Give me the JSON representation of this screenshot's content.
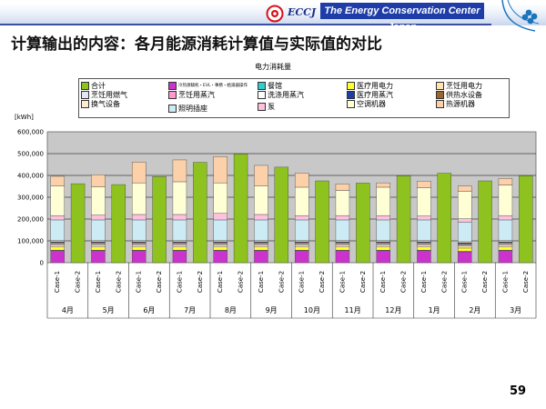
{
  "header": {
    "org_short": "ECCJ",
    "org_name": "The Energy Conservation Center Japan"
  },
  "slide": {
    "title": "计算输出的内容：各月能源消耗计算值与实际值的对比",
    "page_number": "59"
  },
  "chart_data": {
    "type": "bar",
    "stacked": true,
    "title": "电力消耗量",
    "ylabel": "[kWh]",
    "ylim": [
      0,
      600000
    ],
    "yticks": [
      "0",
      "100,000",
      "200,000",
      "300,000",
      "400,000",
      "500,000",
      "600,000"
    ],
    "grid": true,
    "legend_position": "top",
    "months": [
      "4月",
      "5月",
      "6月",
      "7月",
      "8月",
      "9月",
      "10月",
      "11月",
      "12月",
      "1月",
      "2月",
      "3月"
    ],
    "case_labels": [
      "Case-1",
      "Case-2"
    ],
    "series": [
      {
        "name": "合计",
        "color": "#8dc21f",
        "case": "Case-2",
        "values": [
          362000,
          358000,
          395000,
          460000,
          498000,
          438000,
          375000,
          365000,
          398000,
          410000,
          375000,
          398000
        ]
      },
      {
        "name": "冷热源辅机・EVL・事務・給湯器操作",
        "color": "#cc33cc",
        "case": "Case-1",
        "values": [
          55000,
          55000,
          55000,
          55000,
          55000,
          55000,
          55000,
          55000,
          55000,
          55000,
          50000,
          55000
        ]
      },
      {
        "name": "餐馆",
        "color": "#33cccc",
        "case": "Case-1",
        "values": [
          2000,
          2000,
          2000,
          2000,
          2000,
          2000,
          2000,
          2000,
          2000,
          2000,
          2000,
          2000
        ]
      },
      {
        "name": "医疗用电力",
        "color": "#ffff33",
        "case": "Case-1",
        "values": [
          15000,
          15000,
          15000,
          15000,
          15000,
          15000,
          15000,
          15000,
          15000,
          15000,
          15000,
          15000
        ]
      },
      {
        "name": "烹饪用电力",
        "color": "#ffe3b0",
        "case": "Case-1",
        "values": [
          10000,
          10000,
          10000,
          10000,
          10000,
          10000,
          10000,
          10000,
          10000,
          10000,
          10000,
          10000
        ]
      },
      {
        "name": "烹饪用燃气",
        "color": "#e6e6f2",
        "case": "Case-1",
        "values": [
          5000,
          5000,
          5000,
          5000,
          5000,
          5000,
          5000,
          5000,
          5000,
          5000,
          5000,
          5000
        ]
      },
      {
        "name": "烹饪用蒸汽",
        "color": "#ff99cc",
        "case": "Case-1",
        "values": [
          3000,
          3000,
          3000,
          3000,
          3000,
          3000,
          3000,
          3000,
          3000,
          3000,
          3000,
          3000
        ]
      },
      {
        "name": "洗涤用蒸汽",
        "color": "#ffffff",
        "case": "Case-1",
        "values": [
          3000,
          3000,
          3000,
          3000,
          3000,
          3000,
          3000,
          3000,
          3000,
          3000,
          3000,
          3000
        ]
      },
      {
        "name": "医疗用蒸汽",
        "color": "#1f3da8",
        "case": "Case-1",
        "values": [
          1000,
          1000,
          1000,
          1000,
          1000,
          1000,
          1000,
          1000,
          1000,
          1000,
          1000,
          1000
        ]
      },
      {
        "name": "供热水设备",
        "color": "#996633",
        "case": "Case-1",
        "values": [
          2000,
          2000,
          2000,
          2000,
          2000,
          2000,
          2000,
          2000,
          2000,
          2000,
          2000,
          2000
        ]
      },
      {
        "name": "换气设备",
        "color": "#ffebd0",
        "case": "Case-1",
        "values": [
          5000,
          5000,
          5000,
          5000,
          5000,
          5000,
          5000,
          5000,
          5000,
          5000,
          5000,
          5000
        ]
      },
      {
        "name": "照明插座",
        "color": "#ccebf5",
        "case": "Case-1",
        "values": [
          95000,
          95000,
          95000,
          95000,
          95000,
          95000,
          95000,
          95000,
          95000,
          95000,
          90000,
          95000
        ]
      },
      {
        "name": "泵",
        "color": "#ffc0e0",
        "case": "Case-1",
        "values": [
          20000,
          22000,
          25000,
          25000,
          30000,
          25000,
          20000,
          20000,
          20000,
          18000,
          15000,
          20000
        ]
      },
      {
        "name": "空调机器",
        "color": "#ffffd6",
        "case": "Case-1",
        "values": [
          135000,
          130000,
          145000,
          150000,
          140000,
          130000,
          130000,
          115000,
          130000,
          130000,
          125000,
          140000
        ]
      },
      {
        "name": "热源机器",
        "color": "#fcd0a8",
        "case": "Case-1",
        "values": [
          45000,
          55000,
          95000,
          100000,
          120000,
          95000,
          65000,
          30000,
          20000,
          30000,
          25000,
          30000
        ]
      }
    ]
  }
}
